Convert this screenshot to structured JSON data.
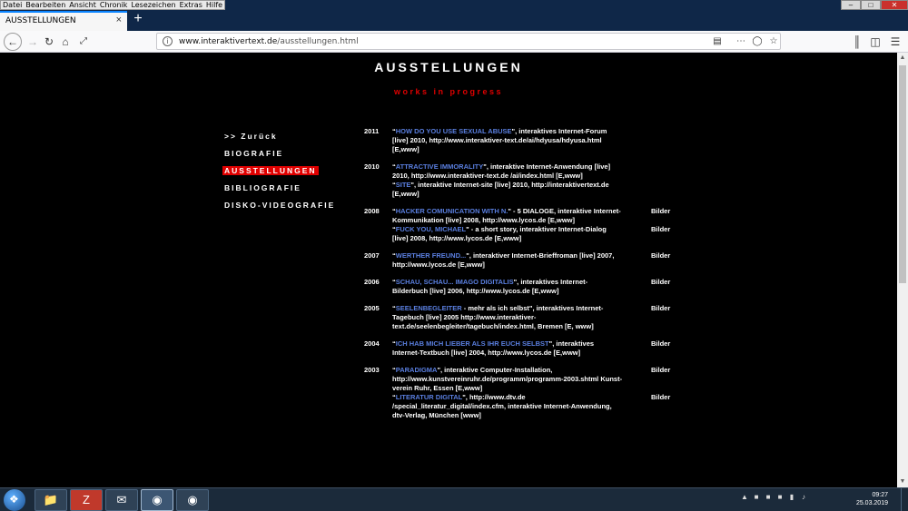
{
  "browser": {
    "menu": [
      "Datei",
      "Bearbeiten",
      "Ansicht",
      "Chronik",
      "Lesezeichen",
      "Extras",
      "Hilfe"
    ],
    "tab_title": "AUSSTELLUNGEN",
    "tab_close": "×",
    "new_tab": "+",
    "url_domain": "www.interaktivertext.de",
    "url_path": "/ausstellungen.html",
    "window_controls": [
      "–",
      "□",
      "✕"
    ]
  },
  "page": {
    "title": "AUSSTELLUNGEN",
    "subtitle": "works in progress",
    "nav": [
      {
        "label": ">> Zurück",
        "active": false
      },
      {
        "label": "BIOGRAFIE",
        "active": false
      },
      {
        "label": "AUSSTELLUNGEN",
        "active": true
      },
      {
        "label": "BIBLIOGRAFIE",
        "active": false
      },
      {
        "label": "DISKO-VIDEOGRAFIE",
        "active": false
      }
    ],
    "years": [
      {
        "year": "2011",
        "entries": [
          {
            "title": "HOW DO YOU USE SEXUAL ABUSE",
            "text": "\", interaktives Internet-Forum [live] 2010, http://www.interaktiver-text.de/ai/hdyusa/hdyusa.html [E,www]",
            "bilder": ""
          }
        ]
      },
      {
        "year": "2010",
        "entries": [
          {
            "title": "ATTRACTIVE IMMORALITY",
            "text": "\", interaktive Internet-Anwendung [live] 2010, http://www.interaktiver-text.de /ai/index.html [E,www]",
            "bilder": ""
          },
          {
            "title": "SITE",
            "text": "\", interaktive Internet-site [live] 2010, http://interaktivertext.de [E,www]",
            "bilder": ""
          }
        ]
      },
      {
        "year": "2008",
        "entries": [
          {
            "title": "HACKER COMUNICATION WITH N.",
            "text": "\" - 5 DIALOGE, interaktive Internet-Kommunikation [live] 2008, http://www.lycos.de [E,www]",
            "bilder": "Bilder"
          },
          {
            "title": "FUCK YOU, MICHAEL",
            "text": "\" - a short story, interaktiver Internet-Dialog [live] 2008, http://www.lycos.de [E,www]",
            "bilder": "Bilder"
          }
        ]
      },
      {
        "year": "2007",
        "entries": [
          {
            "title": "WERTHER FREUND...",
            "text": "\", interaktiver Internet-Brieffroman [live] 2007, http://www.lycos.de [E,www]",
            "bilder": "Bilder"
          }
        ]
      },
      {
        "year": "2006",
        "entries": [
          {
            "title": "SCHAU, SCHAU... IMAGO DIGITALIS",
            "text": "\", interaktives Internet-Bilderbuch [live] 2006, http://www.lycos.de [E,www]",
            "bilder": "Bilder"
          }
        ]
      },
      {
        "year": "2005",
        "entries": [
          {
            "title": "SEELENBEGLEITER",
            "text": " - mehr als ich selbst\", interaktives Internet-Tagebuch [live] 2005 http://www.interaktiver-text.de/seelenbegleiter/tagebuch/index.html, Bremen [E, www]",
            "bilder": "Bilder"
          }
        ]
      },
      {
        "year": "2004",
        "entries": [
          {
            "title": "ICH HAB MICH LIEBER ALS IHR EUCH SELBST",
            "text": "\", interaktives Internet-Textbuch [live] 2004, http://www.lycos.de [E,www]",
            "bilder": "Bilder"
          }
        ]
      },
      {
        "year": "2003",
        "entries": [
          {
            "title": "PARADIGMA",
            "text": "\", interaktive Computer-Installation, http://www.kunstvereinruhr.de/programm/programm-2003.shtml Kunst- verein Ruhr, Essen [E,www]",
            "bilder": "Bilder"
          },
          {
            "title": "LITERATUR DIGITAL",
            "text": "\", http://www.dtv.de /special_literatur_digital/index.cfm, interaktive Internet-Anwendung, dtv-Verlag, München [www]",
            "bilder": "Bilder"
          }
        ]
      }
    ]
  },
  "taskbar": {
    "time": "09:27",
    "date": "25.03.2019"
  },
  "colors": {
    "link": "#5a7fe0",
    "accent_red": "#e00000",
    "page_bg": "#000000",
    "firefox_blue": "#0a84ff"
  }
}
